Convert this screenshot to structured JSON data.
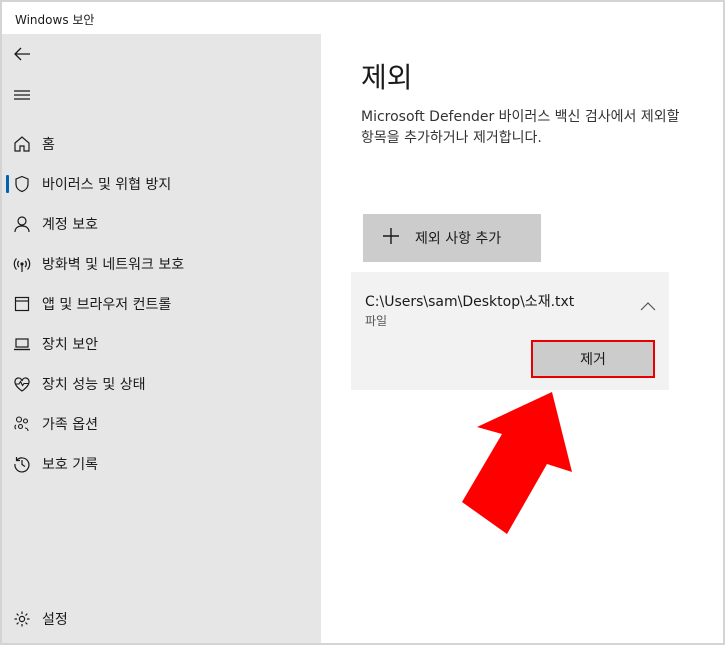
{
  "window": {
    "title": "Windows 보안"
  },
  "sidebar": {
    "items": [
      {
        "label": "홈",
        "icon": "home-icon"
      },
      {
        "label": "바이러스 및 위협 방지",
        "icon": "shield-icon",
        "active": true
      },
      {
        "label": "계정 보호",
        "icon": "person-icon"
      },
      {
        "label": "방화벽 및 네트워크 보호",
        "icon": "wireless-icon"
      },
      {
        "label": "앱 및 브라우저 컨트롤",
        "icon": "app-window-icon"
      },
      {
        "label": "장치 보안",
        "icon": "laptop-icon"
      },
      {
        "label": "장치 성능 및 상태",
        "icon": "heart-pulse-icon"
      },
      {
        "label": "가족 옵션",
        "icon": "family-icon"
      },
      {
        "label": "보호 기록",
        "icon": "history-icon"
      }
    ],
    "settings_label": "설정"
  },
  "main": {
    "title": "제외",
    "description": "Microsoft Defender 바이러스 백신 검사에서 제외할 항목을 추가하거나 제거합니다.",
    "add_button_label": "제외 사항 추가",
    "exclusion": {
      "path": "C:\\Users\\sam\\Desktop\\소재.txt",
      "type": "파일",
      "remove_label": "제거"
    }
  },
  "colors": {
    "sidebar_bg": "#e6e6e6",
    "accent": "#0063b1",
    "highlight": "#e60000"
  }
}
